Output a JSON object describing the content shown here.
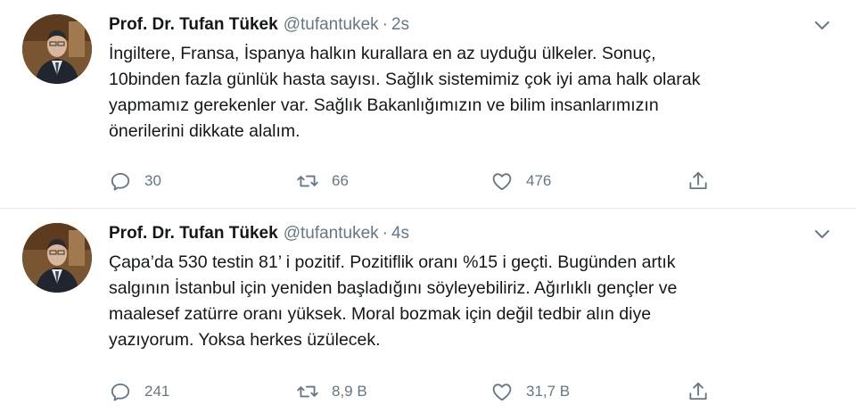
{
  "tweets": [
    {
      "author_name": "Prof. Dr. Tufan Tükek",
      "handle": "@tufantukek",
      "separator": "·",
      "time": "2s",
      "text_lines": [
        "İngiltere, Fransa, İspanya halkın kurallara en az uyduğu ülkeler. Sonuç,",
        "10binden fazla günlük hasta sayısı. Sağlık sistemimiz çok iyi ama halk olarak",
        "yapmamız gerekenler var. Sağlık Bakanlığımızın ve bilim insanlarımızın",
        "önerilerini dikkate alalım."
      ],
      "replies": "30",
      "retweets": "66",
      "likes": "476"
    },
    {
      "author_name": "Prof. Dr. Tufan Tükek",
      "handle": "@tufantukek",
      "separator": "·",
      "time": "4s",
      "text_lines": [
        "Çapa’da 530 testin 81’ i pozitif. Pozitiflik oranı %15 i geçti. Bugünden artık",
        "salgının İstanbul için yeniden başladığını söyleyebiliriz. Ağırlıklı gençler ve",
        "maalesef zatürre oranı yüksek. Moral bozmak için değil tedbir alın diye",
        "yazıyorum. Yoksa herkes üzülecek."
      ],
      "replies": "241",
      "retweets": "8,9 B",
      "likes": "31,7 B"
    }
  ],
  "icons": {
    "reply": "reply-icon",
    "retweet": "retweet-icon",
    "like": "heart-icon",
    "share": "share-icon",
    "caret": "chevron-down-icon"
  },
  "colors": {
    "text_primary": "#14171a",
    "text_secondary": "#657786",
    "divider": "#e1e8ed"
  }
}
